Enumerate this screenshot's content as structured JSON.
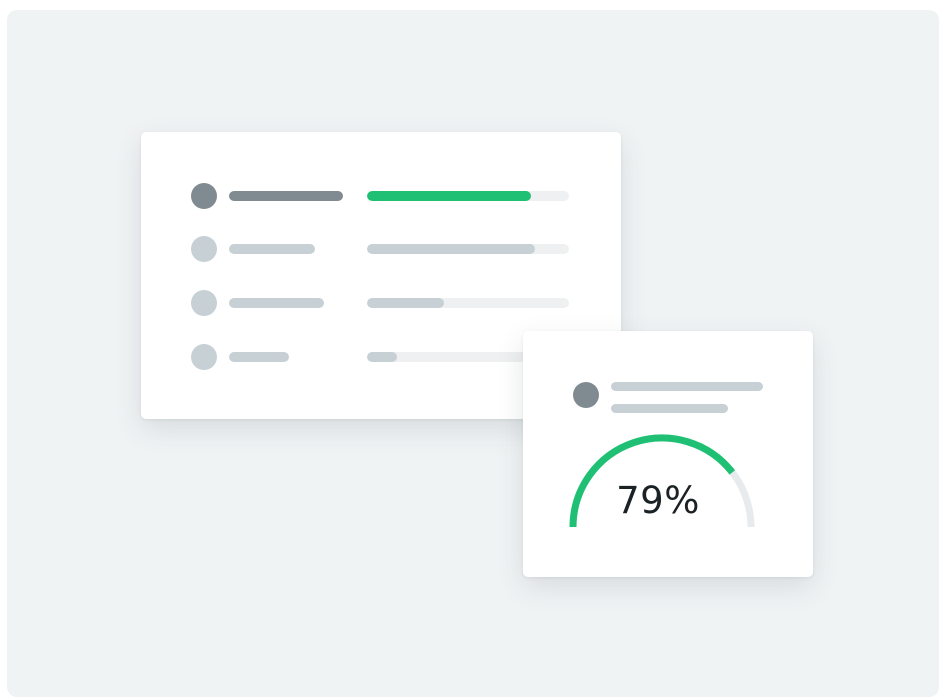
{
  "colors": {
    "background": "#f0f3f4",
    "accent": "#1fc074",
    "avatar_dark": "#7f8b91",
    "avatar_light": "#c7d0d4",
    "placeholder_light": "#c7d0d4",
    "track": "#eef0f1",
    "gauge_track": "#e8ebed",
    "text_dark": "#1b2226"
  },
  "list_card": {
    "rows": [
      {
        "avatar_color": "#7f8b91",
        "name_color": "#7f8b91",
        "progress": 0.81,
        "progress_color": "#1fc074"
      },
      {
        "avatar_color": "#c7d0d4",
        "name_color": "#c7d0d4",
        "progress": 0.83,
        "progress_color": "#c7d0d4"
      },
      {
        "avatar_color": "#c7d0d4",
        "name_color": "#c7d0d4",
        "progress": 0.38,
        "progress_color": "#c7d0d4"
      },
      {
        "avatar_color": "#c7d0d4",
        "name_color": "#c7d0d4",
        "progress": 0.15,
        "progress_color": "#c7d0d4"
      }
    ]
  },
  "gauge_card": {
    "value_text": "79%",
    "value_fraction": 0.79,
    "avatar_color": "#7f8b91",
    "accent_color": "#1fc074",
    "track_color": "#e8ebed"
  }
}
